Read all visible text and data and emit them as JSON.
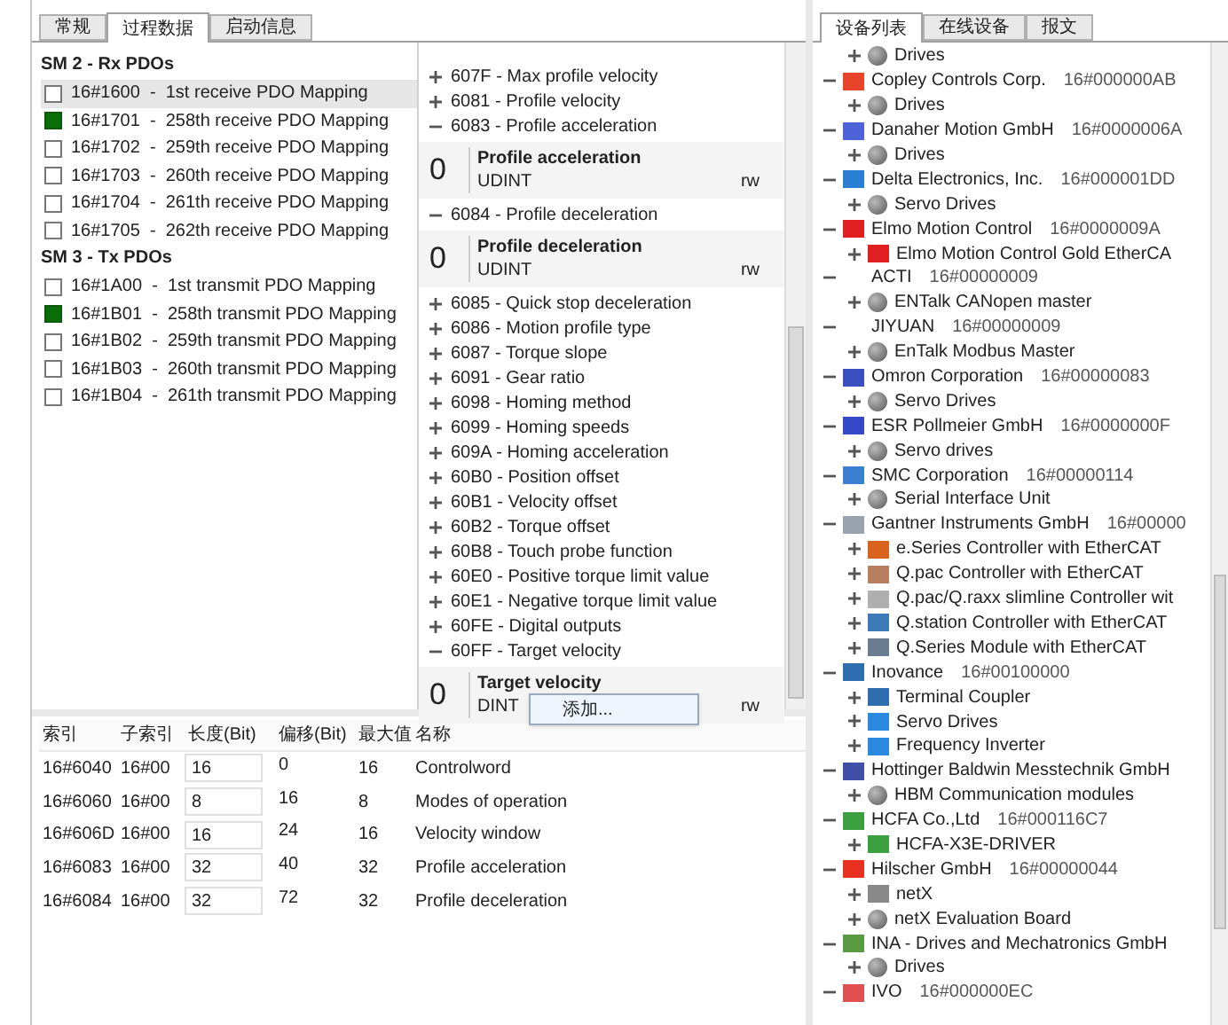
{
  "left_tabs": [
    {
      "label": "常规",
      "selected": false
    },
    {
      "label": "过程数据",
      "selected": true
    },
    {
      "label": "启动信息",
      "selected": false
    }
  ],
  "pdo_groups": [
    {
      "title": "SM 2 - Rx PDOs",
      "items": [
        {
          "label": "16#1600  -  1st receive PDO Mapping",
          "checked": false,
          "selected": true
        },
        {
          "label": "16#1701  -  258th receive PDO Mapping",
          "checked": true,
          "selected": false
        },
        {
          "label": "16#1702  -  259th receive PDO Mapping",
          "checked": false,
          "selected": false
        },
        {
          "label": "16#1703  -  260th receive PDO Mapping",
          "checked": false,
          "selected": false
        },
        {
          "label": "16#1704  -  261th receive PDO Mapping",
          "checked": false,
          "selected": false
        },
        {
          "label": "16#1705  -  262th receive PDO Mapping",
          "checked": false,
          "selected": false
        }
      ]
    },
    {
      "title": "SM 3 - Tx PDOs",
      "items": [
        {
          "label": "16#1A00  -  1st transmit PDO Mapping",
          "checked": false,
          "selected": false
        },
        {
          "label": "16#1B01  -  258th transmit PDO Mapping",
          "checked": true,
          "selected": false
        },
        {
          "label": "16#1B02  -  259th transmit PDO Mapping",
          "checked": false,
          "selected": false
        },
        {
          "label": "16#1B03  -  260th transmit PDO Mapping",
          "checked": false,
          "selected": false
        },
        {
          "label": "16#1B04  -  261th transmit PDO Mapping",
          "checked": false,
          "selected": false
        }
      ]
    }
  ],
  "objects": [
    {
      "label": "607F - Max profile velocity",
      "expanded": false
    },
    {
      "label": "6081 - Profile velocity",
      "expanded": false
    },
    {
      "label": "6083 - Profile acceleration",
      "expanded": true,
      "detail": {
        "value": "0",
        "name": "Profile acceleration",
        "type": "UDINT",
        "access": "rw"
      }
    },
    {
      "label": "6084 - Profile deceleration",
      "expanded": true,
      "detail": {
        "value": "0",
        "name": "Profile deceleration",
        "type": "UDINT",
        "access": "rw"
      }
    },
    {
      "label": "6085 - Quick stop deceleration",
      "expanded": false
    },
    {
      "label": "6086 - Motion profile type",
      "expanded": false
    },
    {
      "label": "6087 - Torque slope",
      "expanded": false
    },
    {
      "label": "6091 - Gear ratio",
      "expanded": false
    },
    {
      "label": "6098 - Homing method",
      "expanded": false
    },
    {
      "label": "6099 - Homing speeds",
      "expanded": false
    },
    {
      "label": "609A - Homing acceleration",
      "expanded": false
    },
    {
      "label": "60B0 - Position offset",
      "expanded": false
    },
    {
      "label": "60B1 - Velocity offset",
      "expanded": false
    },
    {
      "label": "60B2 - Torque offset",
      "expanded": false
    },
    {
      "label": "60B8 - Touch probe function",
      "expanded": false
    },
    {
      "label": "60E0 - Positive torque limit value",
      "expanded": false
    },
    {
      "label": "60E1 - Negative torque limit value",
      "expanded": false
    },
    {
      "label": "60FE - Digital outputs",
      "expanded": false
    },
    {
      "label": "60FF - Target velocity",
      "expanded": true,
      "detail": {
        "value": "0",
        "name": "Target velocity",
        "type": "DINT",
        "access": "rw"
      }
    }
  ],
  "context_menu": {
    "item": "添加..."
  },
  "mapping_table": {
    "columns": [
      "索引",
      "子索引",
      "长度(Bit)",
      "偏移(Bit)",
      "最大值",
      "名称"
    ],
    "rows": [
      [
        "16#6040",
        "16#00",
        "16",
        "0",
        "16",
        "Controlword"
      ],
      [
        "16#6060",
        "16#00",
        "8",
        "16",
        "8",
        "Modes of operation"
      ],
      [
        "16#606D",
        "16#00",
        "16",
        "24",
        "16",
        "Velocity window"
      ],
      [
        "16#6083",
        "16#00",
        "32",
        "40",
        "32",
        "Profile acceleration"
      ],
      [
        "16#6084",
        "16#00",
        "32",
        "72",
        "32",
        "Profile deceleration"
      ]
    ]
  },
  "right_tabs": [
    {
      "label": "设备列表",
      "selected": true
    },
    {
      "label": "在线设备",
      "selected": false
    },
    {
      "label": "报文",
      "selected": false
    }
  ],
  "device_tree": [
    {
      "children": [
        {
          "name": "Drives"
        }
      ]
    },
    {
      "name": "Copley Controls Corp.",
      "id": "16#000000AB",
      "color": "#e8442c",
      "children": [
        {
          "name": "Drives"
        }
      ]
    },
    {
      "name": "Danaher Motion GmbH",
      "id": "16#0000006A",
      "color": "#4f63d8",
      "children": [
        {
          "name": "Drives"
        }
      ]
    },
    {
      "name": "Delta Electronics, Inc.",
      "id": "16#000001DD",
      "color": "#2a7fd4",
      "children": [
        {
          "name": "Servo Drives"
        }
      ]
    },
    {
      "name": "Elmo Motion Control",
      "id": "16#0000009A",
      "color": "#e02020",
      "children": [
        {
          "name": "Elmo Motion Control Gold EtherCA",
          "color": "#e02020"
        }
      ]
    },
    {
      "name": "ACTI",
      "id": "16#00000009",
      "children": [
        {
          "name": "ENTalk CANopen master"
        }
      ]
    },
    {
      "name": "JIYUAN",
      "id": "16#00000009",
      "children": [
        {
          "name": "EnTalk Modbus Master"
        }
      ]
    },
    {
      "name": "Omron Corporation",
      "id": "16#00000083",
      "color": "#3a4fc0",
      "children": [
        {
          "name": "Servo Drives"
        }
      ]
    },
    {
      "name": "ESR Pollmeier GmbH",
      "id": "16#0000000F",
      "color": "#3548c8",
      "children": [
        {
          "name": "Servo drives"
        }
      ]
    },
    {
      "name": "SMC Corporation",
      "id": "16#00000114",
      "color": "#3a7fd0",
      "children": [
        {
          "name": "Serial Interface Unit"
        }
      ]
    },
    {
      "name": "Gantner Instruments GmbH",
      "id": "16#00000",
      "color": "#9aa3ad",
      "children": [
        {
          "name": "e.Series Controller with EtherCAT",
          "color": "#d9621c"
        },
        {
          "name": "Q.pac Controller with EtherCAT",
          "color": "#b88060"
        },
        {
          "name": "Q.pac/Q.raxx slimline Controller wit",
          "color": "#b0b0b0"
        },
        {
          "name": "Q.station Controller with EtherCAT",
          "color": "#3c7ab8"
        },
        {
          "name": "Q.Series Module with EtherCAT",
          "color": "#6a7c90"
        }
      ]
    },
    {
      "name": "Inovance",
      "id": "16#00100000",
      "color": "#2f6fb0",
      "children": [
        {
          "name": "Terminal Coupler",
          "color": "#2f6fb0"
        },
        {
          "name": "Servo Drives",
          "color": "#2a8ae0"
        },
        {
          "name": "Frequency Inverter",
          "color": "#2a8ae0"
        }
      ]
    },
    {
      "name": "Hottinger Baldwin Messtechnik GmbH",
      "color": "#4050a8",
      "children": [
        {
          "name": "HBM Communication modules"
        }
      ]
    },
    {
      "name": "HCFA Co.,Ltd",
      "id": "16#000116C7",
      "color": "#3ca040",
      "children": [
        {
          "name": "HCFA-X3E-DRIVER",
          "color": "#3ca040"
        }
      ]
    },
    {
      "name": "Hilscher GmbH",
      "id": "16#00000044",
      "color": "#e83020",
      "children": [
        {
          "name": "netX",
          "color": "#888888"
        },
        {
          "name": "netX Evaluation Board"
        }
      ]
    },
    {
      "name": "INA - Drives and Mechatronics GmbH",
      "color": "#5a9a40",
      "children": [
        {
          "name": "Drives"
        }
      ]
    },
    {
      "name": "IVO",
      "id": "16#000000EC",
      "color": "#e05050"
    }
  ]
}
